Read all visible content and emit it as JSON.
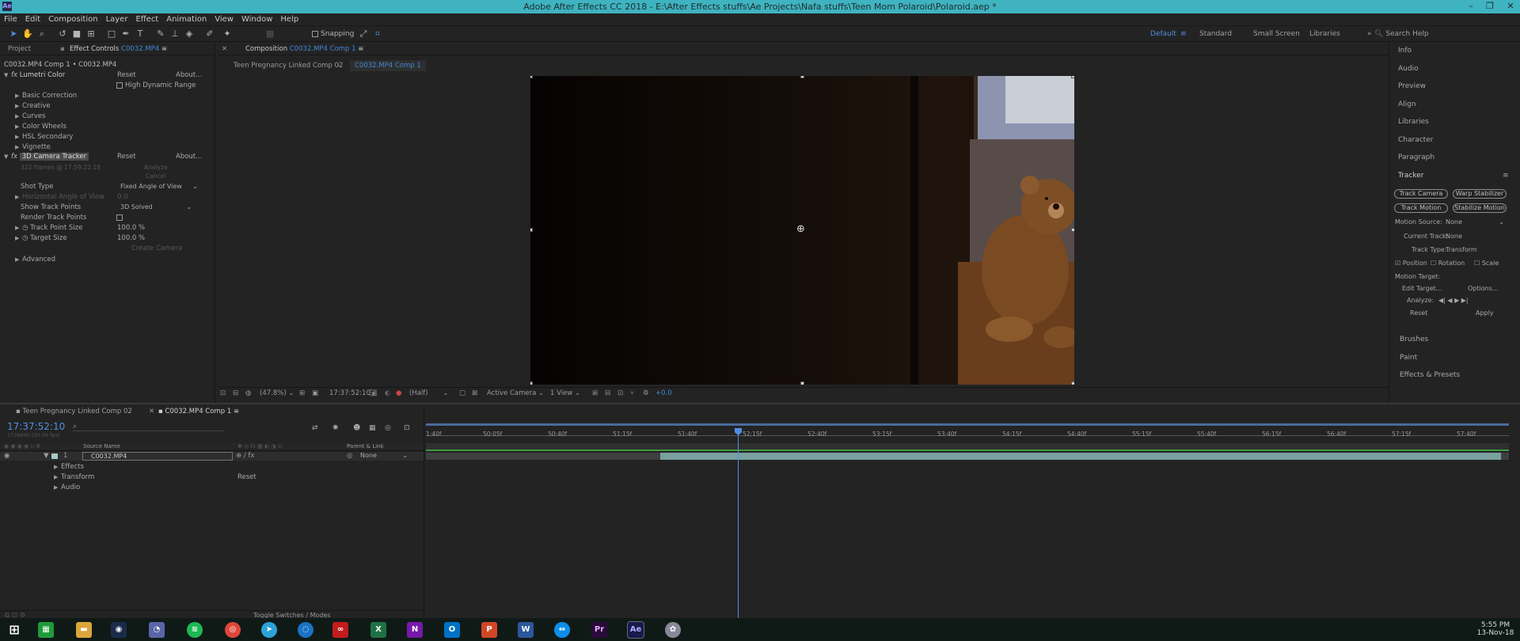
{
  "title": "Adobe After Effects CC 2018 - E:\\After Effects stuffs\\Ae Projects\\Nafa stuffs\\Teen Mom Polaroid\\Polaroid.aep *",
  "menu": [
    "File",
    "Edit",
    "Composition",
    "Layer",
    "Effect",
    "Animation",
    "View",
    "Window",
    "Help"
  ],
  "toolbar": {
    "snapping": "Snapping",
    "workspaces": [
      "Default",
      "Standard",
      "Small Screen",
      "Libraries"
    ],
    "search_help": "Search Help"
  },
  "left_panel": {
    "tab_project": "Project",
    "tab_effect_controls": "Effect Controls",
    "tab_effect_controls_target": "C0032.MP4",
    "breadcrumb": "C0032.MP4 Comp 1 • C0032.MP4",
    "lumetri": {
      "name": "Lumetri Color",
      "reset": "Reset",
      "about": "About...",
      "hdr": "High Dynamic Range",
      "groups": [
        "Basic Correction",
        "Creative",
        "Curves",
        "Color Wheels",
        "HSL Secondary",
        "Vignette"
      ]
    },
    "tracker": {
      "name": "3D Camera Tracker",
      "reset": "Reset",
      "about": "About...",
      "status": "322 frames @ 17:59:22:18",
      "analyze": "Analyze",
      "cancel": "Cancel",
      "shot_type_label": "Shot Type",
      "shot_type_value": "Fixed Angle of View",
      "haov_label": "Horizontal Angle of View",
      "haov_value": "0.0",
      "show_tp_label": "Show Track Points",
      "show_tp_value": "3D Solved",
      "render_tp_label": "Render Track Points",
      "tp_size_label": "Track Point Size",
      "tp_size_value": "100.0 %",
      "target_size_label": "Target Size",
      "target_size_value": "100.0 %",
      "create_camera": "Create Camera",
      "advanced": "Advanced"
    }
  },
  "comp_panel": {
    "tab_label": "Composition",
    "tab_target": "C0032.MP4 Comp 1",
    "nav": [
      "Teen Pregnancy Linked Comp 02",
      "C0032.MP4 Comp 1"
    ],
    "bottom_bar": {
      "zoom": "(47.8%)",
      "timecode": "17:37:52:10",
      "resolution": "(Half)",
      "camera": "Active Camera",
      "view": "1 View",
      "exposure": "+0.0"
    }
  },
  "right_panel": {
    "items_top": [
      "Info",
      "Audio",
      "Preview",
      "Align",
      "Libraries",
      "Character",
      "Paragraph"
    ],
    "tracker_title": "Tracker",
    "buttons": [
      "Track Camera",
      "Warp Stabilizer",
      "Track Motion",
      "Stabilize Motion"
    ],
    "motion_source_label": "Motion Source:",
    "motion_source_value": "None",
    "current_track_label": "Current Track:",
    "current_track_value": "None",
    "track_type_label": "Track Type:",
    "track_type_value": "Transform",
    "checks": [
      "Position",
      "Rotation",
      "Scale"
    ],
    "motion_target": "Motion Target:",
    "edit_target": "Edit Target...",
    "options": "Options...",
    "analyze": "Analyze:",
    "reset": "Reset",
    "apply": "Apply",
    "items_bottom": [
      "Brushes",
      "Paint",
      "Effects & Presets"
    ]
  },
  "timeline": {
    "tabs": [
      "Teen Pregnancy Linked Comp 02",
      "C0032.MP4 Comp 1"
    ],
    "timecode": "17:37:52:10",
    "sub_timecode": "3739840 (30.00 fps)",
    "col_source": "Source Name",
    "col_parent": "Parent & Link",
    "layer_num": "1",
    "layer_name": "C0032.MP4",
    "parent_value": "None",
    "props": [
      "Effects",
      "Transform",
      "Audio"
    ],
    "transform_reset": "Reset",
    "ruler": [
      "1:40f",
      "50:05f",
      "50:40f",
      "51:15f",
      "51:40f",
      "52:15f",
      "52:40f",
      "53:15f",
      "53:40f",
      "54:15f",
      "54:40f",
      "55:15f",
      "55:40f",
      "56:15f",
      "56:40f",
      "57:15f",
      "57:40f"
    ],
    "toggle": "Toggle Switches / Modes"
  },
  "taskbar": {
    "time": "5:55 PM",
    "date": "13-Nov-18"
  }
}
